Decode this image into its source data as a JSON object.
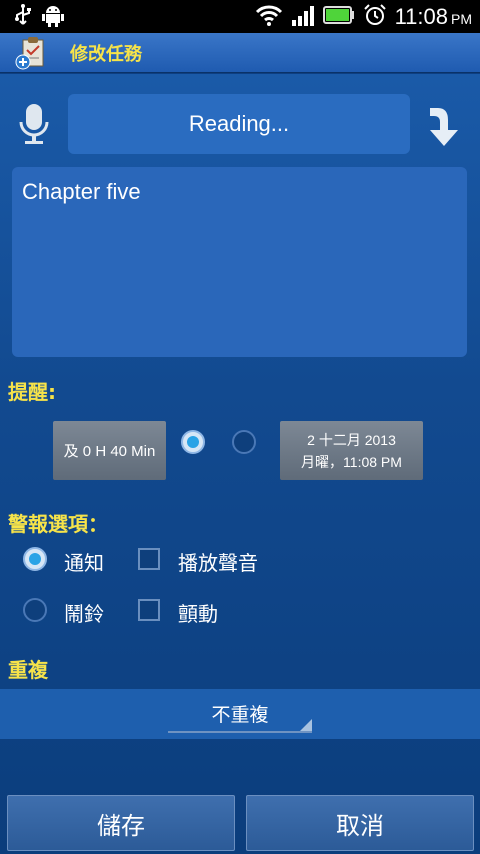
{
  "status_bar": {
    "time": "11:08",
    "ampm": "PM",
    "icons": [
      "usb-icon",
      "android-debug-icon",
      "wifi-icon",
      "signal-icon",
      "battery-icon",
      "alarm-icon"
    ]
  },
  "title_bar": {
    "title": "修改任務"
  },
  "voice": {
    "reading_label": "Reading..."
  },
  "task_text": "Chapter five",
  "reminder": {
    "label": "提醒:",
    "relative_button": "及 0 H 40 Min",
    "date_line1": "2  十二月  2013",
    "date_line2": "月曜，11:08 PM",
    "relative_selected": true
  },
  "alert_options": {
    "label": "警報選項：",
    "notify_label": "通知",
    "play_sound_label": "播放聲音",
    "alarm_label": "鬧鈴",
    "vibrate_label": "顫動",
    "notify_selected": true,
    "alarm_selected": false,
    "play_sound_checked": false,
    "vibrate_checked": false
  },
  "repeat": {
    "label": "重複",
    "selected": "不重複"
  },
  "actions": {
    "save_label": "儲存",
    "cancel_label": "取消"
  },
  "colors": {
    "accent_yellow": "#f6e34a",
    "background_blue": "#0d3f82",
    "radio_dot": "#2aa3e6"
  }
}
